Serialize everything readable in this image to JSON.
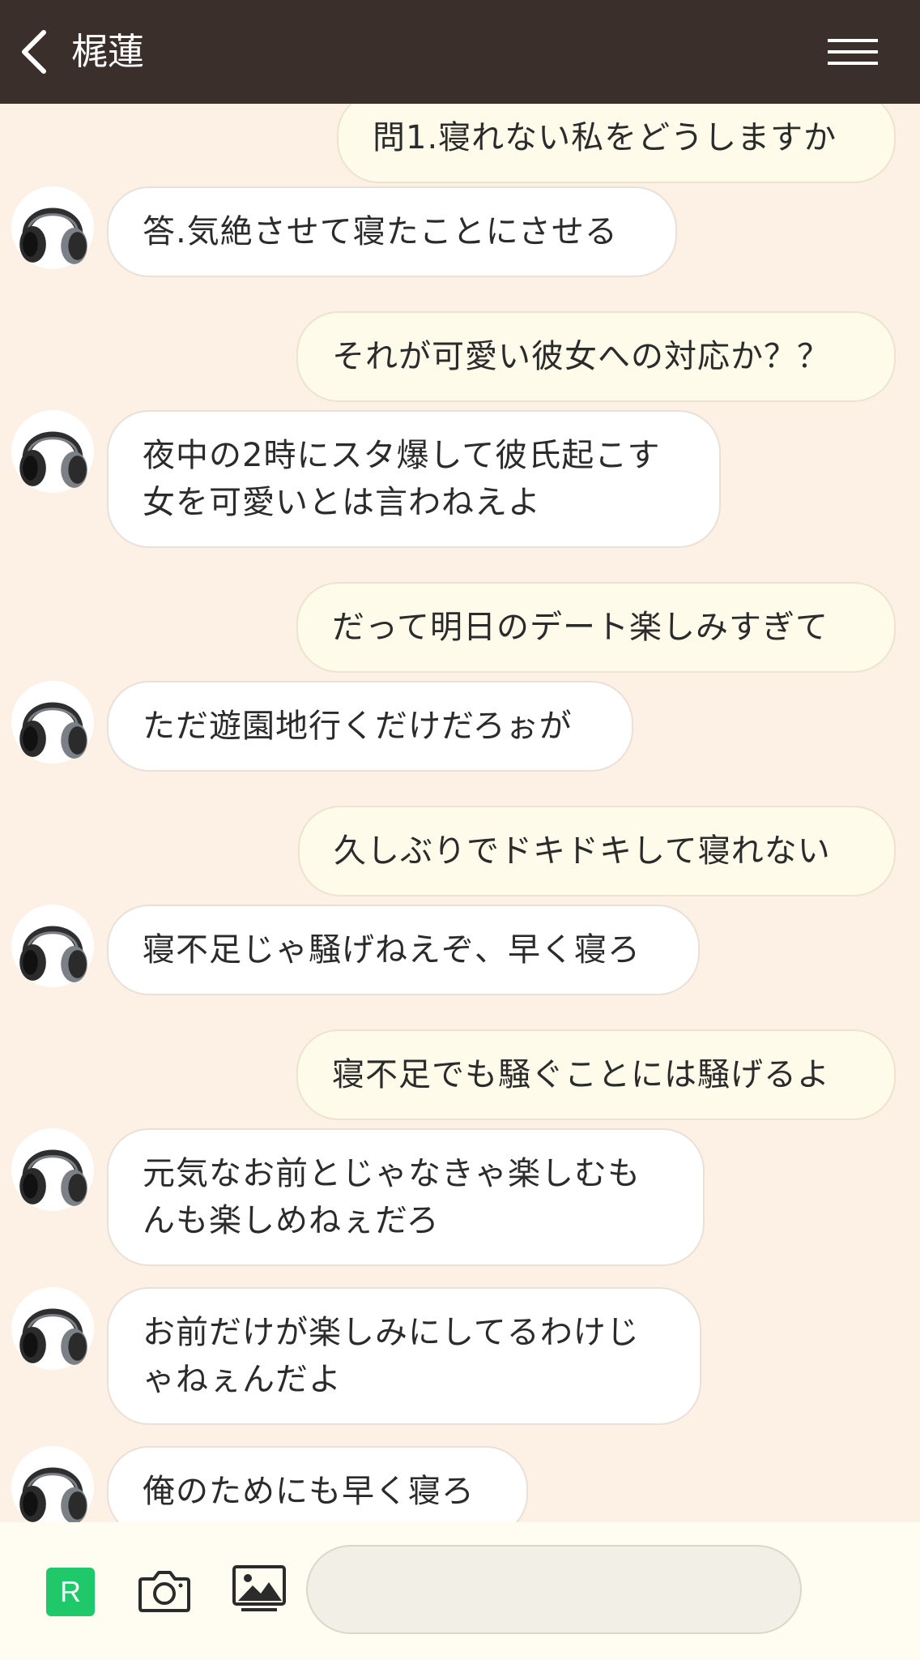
{
  "header": {
    "title": "梶蓮"
  },
  "messages": [
    {
      "side": "out",
      "text": "問1.寝れない私をどうしますか"
    },
    {
      "side": "in",
      "text": "答.気絶させて寝たことにさせる"
    },
    {
      "side": "out",
      "text": "それが可愛い彼女への対応か？？"
    },
    {
      "side": "in",
      "text": "夜中の2時にスタ爆して彼氏起こす\n女を可愛いとは言わねえよ"
    },
    {
      "side": "out",
      "text": "だって明日のデート楽しみすぎて"
    },
    {
      "side": "in",
      "text": "ただ遊園地行くだけだろぉが"
    },
    {
      "side": "out",
      "text": "久しぶりでドキドキして寝れない"
    },
    {
      "side": "in",
      "text": "寝不足じゃ騒げねえぞ、早く寝ろ"
    },
    {
      "side": "out",
      "text": "寝不足でも騒ぐことには騒げるよ"
    },
    {
      "side": "in",
      "text": "元気なお前とじゃなきゃ楽しむも\nんも楽しめねぇだろ"
    },
    {
      "side": "in",
      "text": "お前だけが楽しみにしてるわけじ\nゃねぇんだよ"
    },
    {
      "side": "in",
      "text": "俺のためにも早く寝ろ"
    }
  ],
  "footer": {
    "r_label": "R",
    "input_placeholder": ""
  },
  "colors": {
    "header_bg": "#3a2f2b",
    "chat_bg": "#fdf0e4",
    "out_bubble": "#fffbea",
    "in_bubble": "#ffffff",
    "r_badge": "#1fc96a"
  }
}
